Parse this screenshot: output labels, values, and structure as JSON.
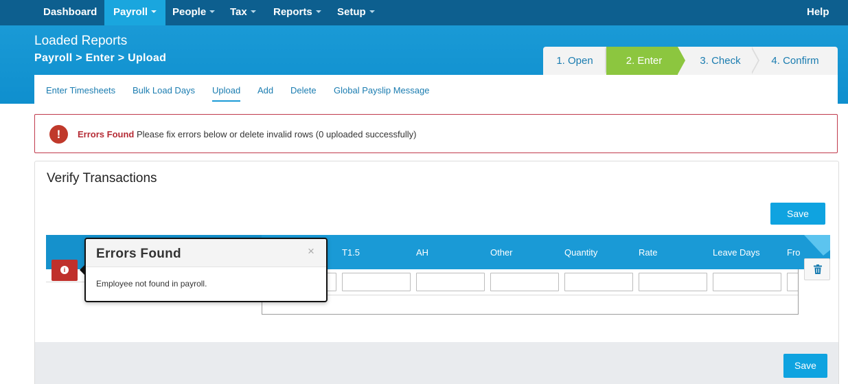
{
  "nav": {
    "items": [
      {
        "label": "Dashboard",
        "dropdown": false,
        "active": false
      },
      {
        "label": "Payroll",
        "dropdown": true,
        "active": true
      },
      {
        "label": "People",
        "dropdown": true,
        "active": false
      },
      {
        "label": "Tax",
        "dropdown": true,
        "active": false
      },
      {
        "label": "Reports",
        "dropdown": true,
        "active": false
      },
      {
        "label": "Setup",
        "dropdown": true,
        "active": false
      }
    ],
    "help": "Help"
  },
  "header": {
    "title": "Loaded Reports",
    "breadcrumb": "Payroll > Enter > Upload"
  },
  "wizard": {
    "steps": [
      "1. Open",
      "2. Enter",
      "3. Check",
      "4. Confirm"
    ],
    "active_step": 2
  },
  "subtabs": {
    "items": [
      "Enter Timesheets",
      "Bulk Load Days",
      "Upload",
      "Add",
      "Delete",
      "Global Payslip Message"
    ],
    "active": "Upload"
  },
  "alert": {
    "icon": "exclamation-circle-icon",
    "strong": "Errors Found",
    "message": " Please fix errors below or delete invalid rows (0 uploaded successfully)"
  },
  "verify": {
    "title": "Verify Transactions",
    "save_label": "Save",
    "footer_save_label": "Save"
  },
  "grid": {
    "columns": [
      "T1.5",
      "AH",
      "Other",
      "Quantity",
      "Rate",
      "Leave Days",
      "Fro"
    ]
  },
  "popover": {
    "title": "Errors Found",
    "close": "×",
    "body": "Employee not found in payroll."
  },
  "colors": {
    "nav_bg": "#0d5f8f",
    "accent": "#1a9ad6",
    "active_step": "#8cc63f",
    "error": "#c0392b"
  }
}
